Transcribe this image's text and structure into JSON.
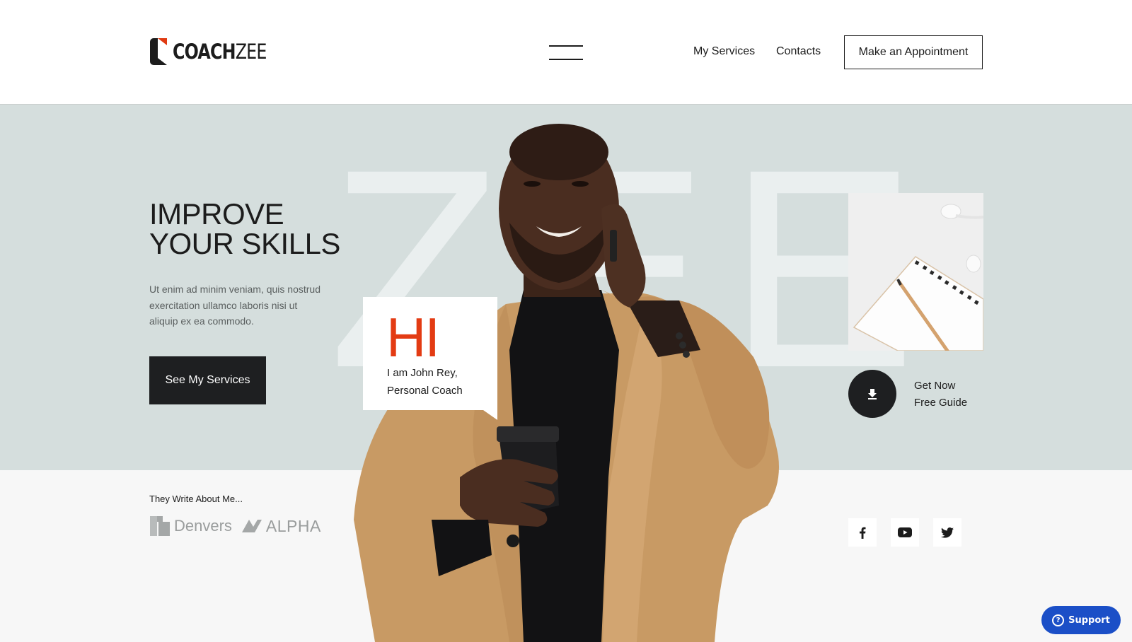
{
  "brand": {
    "name_bold": "COACH",
    "name_light": "ZEE",
    "accent": "#e33b13",
    "dark": "#1e1f21",
    "hero_bg": "#d5dedd"
  },
  "header": {
    "nav": [
      {
        "label": "My Services"
      },
      {
        "label": "Contacts"
      }
    ],
    "appointment_label": "Make an Appointment",
    "menu_icon": "hamburger-icon"
  },
  "hero": {
    "background_word": "ZEE",
    "headline_line1": "IMPROVE",
    "headline_line2": "YOUR SKILLS",
    "lede": "Ut enim ad minim veniam, quis nostrud exercitation ullamco laboris nisi ut aliquip ex ea commodo.",
    "cta_label": "See My Services",
    "greeting": {
      "big": "HI",
      "line1": "I am John Rey,",
      "line2": "Personal Coach"
    },
    "guide": {
      "icon": "download-icon",
      "line1": "Get Now",
      "line2": "Free Guide"
    }
  },
  "press": {
    "title": "They Write About Me...",
    "logos": [
      {
        "name": "Denvers"
      },
      {
        "name": "ALPHA"
      }
    ]
  },
  "social": [
    {
      "icon": "facebook-icon"
    },
    {
      "icon": "youtube-icon"
    },
    {
      "icon": "twitter-icon"
    }
  ],
  "support": {
    "label": "Support",
    "icon": "help-icon"
  }
}
